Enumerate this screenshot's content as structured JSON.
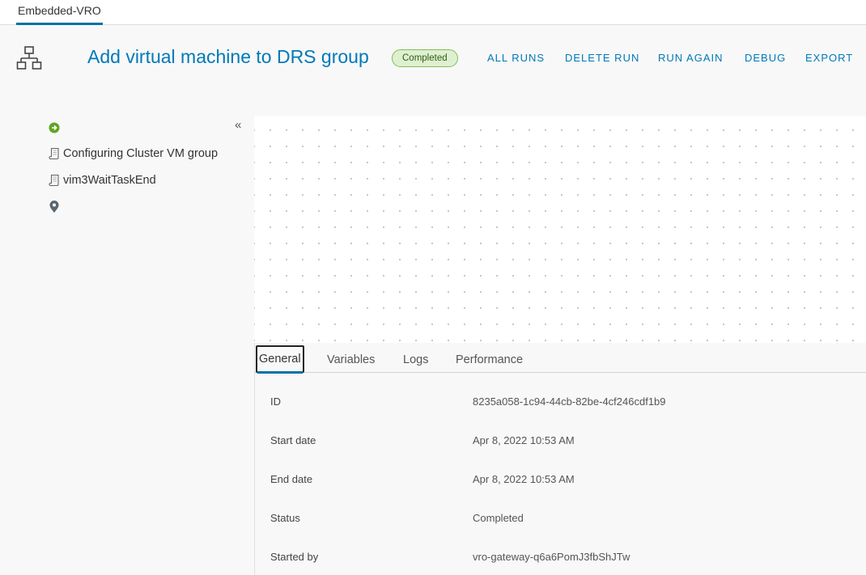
{
  "top_tab": {
    "label": "Embedded-VRO"
  },
  "header": {
    "icon": "workflow-diagram-icon",
    "title": "Add virtual machine to DRS group",
    "status_badge": "Completed",
    "actions": [
      "ALL RUNS",
      "DELETE RUN",
      "RUN AGAIN",
      "DEBUG",
      "EXPORT"
    ]
  },
  "sidebar": {
    "collapse_icon": "double-chevron-left-icon",
    "nodes": [
      {
        "type": "start",
        "icon": "start-icon",
        "label": ""
      },
      {
        "type": "task",
        "icon": "scroll-icon",
        "label": "Configuring Cluster VM group"
      },
      {
        "type": "task",
        "icon": "scroll-icon",
        "label": "vim3WaitTaskEnd"
      },
      {
        "type": "end",
        "icon": "map-pin-icon",
        "label": ""
      }
    ]
  },
  "details": {
    "tabs": [
      "General",
      "Variables",
      "Logs",
      "Performance"
    ],
    "active_tab": "General",
    "rows": [
      {
        "label": "ID",
        "value": "8235a058-1c94-44cb-82be-4cf246cdf1b9"
      },
      {
        "label": "Start date",
        "value": "Apr 8, 2022 10:53 AM"
      },
      {
        "label": "End date",
        "value": "Apr 8, 2022 10:53 AM"
      },
      {
        "label": "Status",
        "value": "Completed"
      },
      {
        "label": "Started by",
        "value": "vro-gateway-q6a6PomJ3fbShJTw"
      }
    ]
  },
  "colors": {
    "accent": "#0079b8",
    "success": "#62a420",
    "badge_bg": "#dff0d0"
  }
}
